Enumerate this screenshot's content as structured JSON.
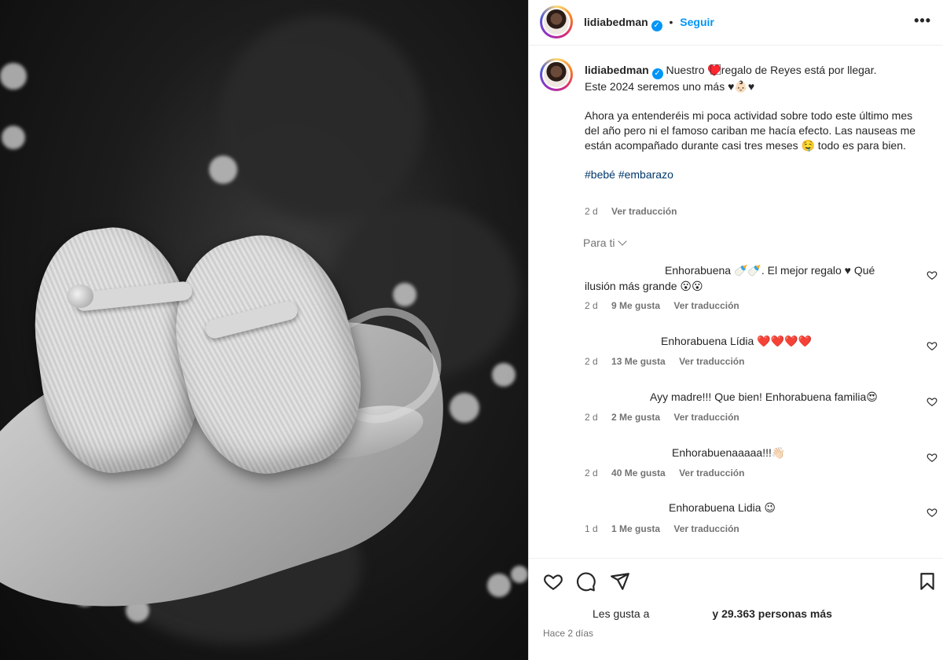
{
  "header": {
    "username": "lidiabedman",
    "separator": "•",
    "follow_label": "Seguir",
    "more_label": "•••"
  },
  "post": {
    "username": "lidiabedman",
    "caption_line1": "Nuestro ♥️⃞⃞regalo de Reyes está por llegar.",
    "caption_line2": "Este 2024 seremos uno más ♥👶🏻♥",
    "caption_para2": "Ahora ya entenderéis mi poca actividad sobre todo este último mes del año pero ni el famoso cariban me hacía efecto. Las nauseas me están acompañado durante casi tres meses 🤤 todo es para bien.",
    "hashtags": "#bebé #embarazo",
    "time": "2 d",
    "translate": "Ver traducción"
  },
  "for_you_label": "Para ti",
  "comments": [
    {
      "text": "Enhorabuena 🍼🍼. El mejor regalo ♥ Qué ilusión más grande 😮😮",
      "time": "2 d",
      "likes": "9 Me gusta",
      "translate": "Ver traducción"
    },
    {
      "text": "Enhorabuena Lídia ❤️❤️❤️❤️",
      "time": "2 d",
      "likes": "13 Me gusta",
      "translate": "Ver traducción"
    },
    {
      "text": "Ayy madre!!! Que bien! Enhorabuena familia😍",
      "time": "2 d",
      "likes": "2 Me gusta",
      "translate": "Ver traducción"
    },
    {
      "text": "Enhorabuenaaaaa!!!👋🏻",
      "time": "2 d",
      "likes": "40 Me gusta",
      "translate": "Ver traducción"
    },
    {
      "text": "Enhorabuena Lidia 😉",
      "time": "1 d",
      "likes": "1 Me gusta",
      "translate": "Ver traducción"
    }
  ],
  "actions": {
    "likes_prefix": "Les gusta a",
    "likes_suffix": "y 29.363 personas más",
    "posted": "Hace 2 días"
  },
  "icons": [
    "heart-icon",
    "comment-icon",
    "share-icon",
    "bookmark-icon",
    "verified-icon",
    "more-icon"
  ],
  "colors": {
    "accent": "#0095f6",
    "hashtag": "#00376b",
    "muted": "#737373"
  }
}
